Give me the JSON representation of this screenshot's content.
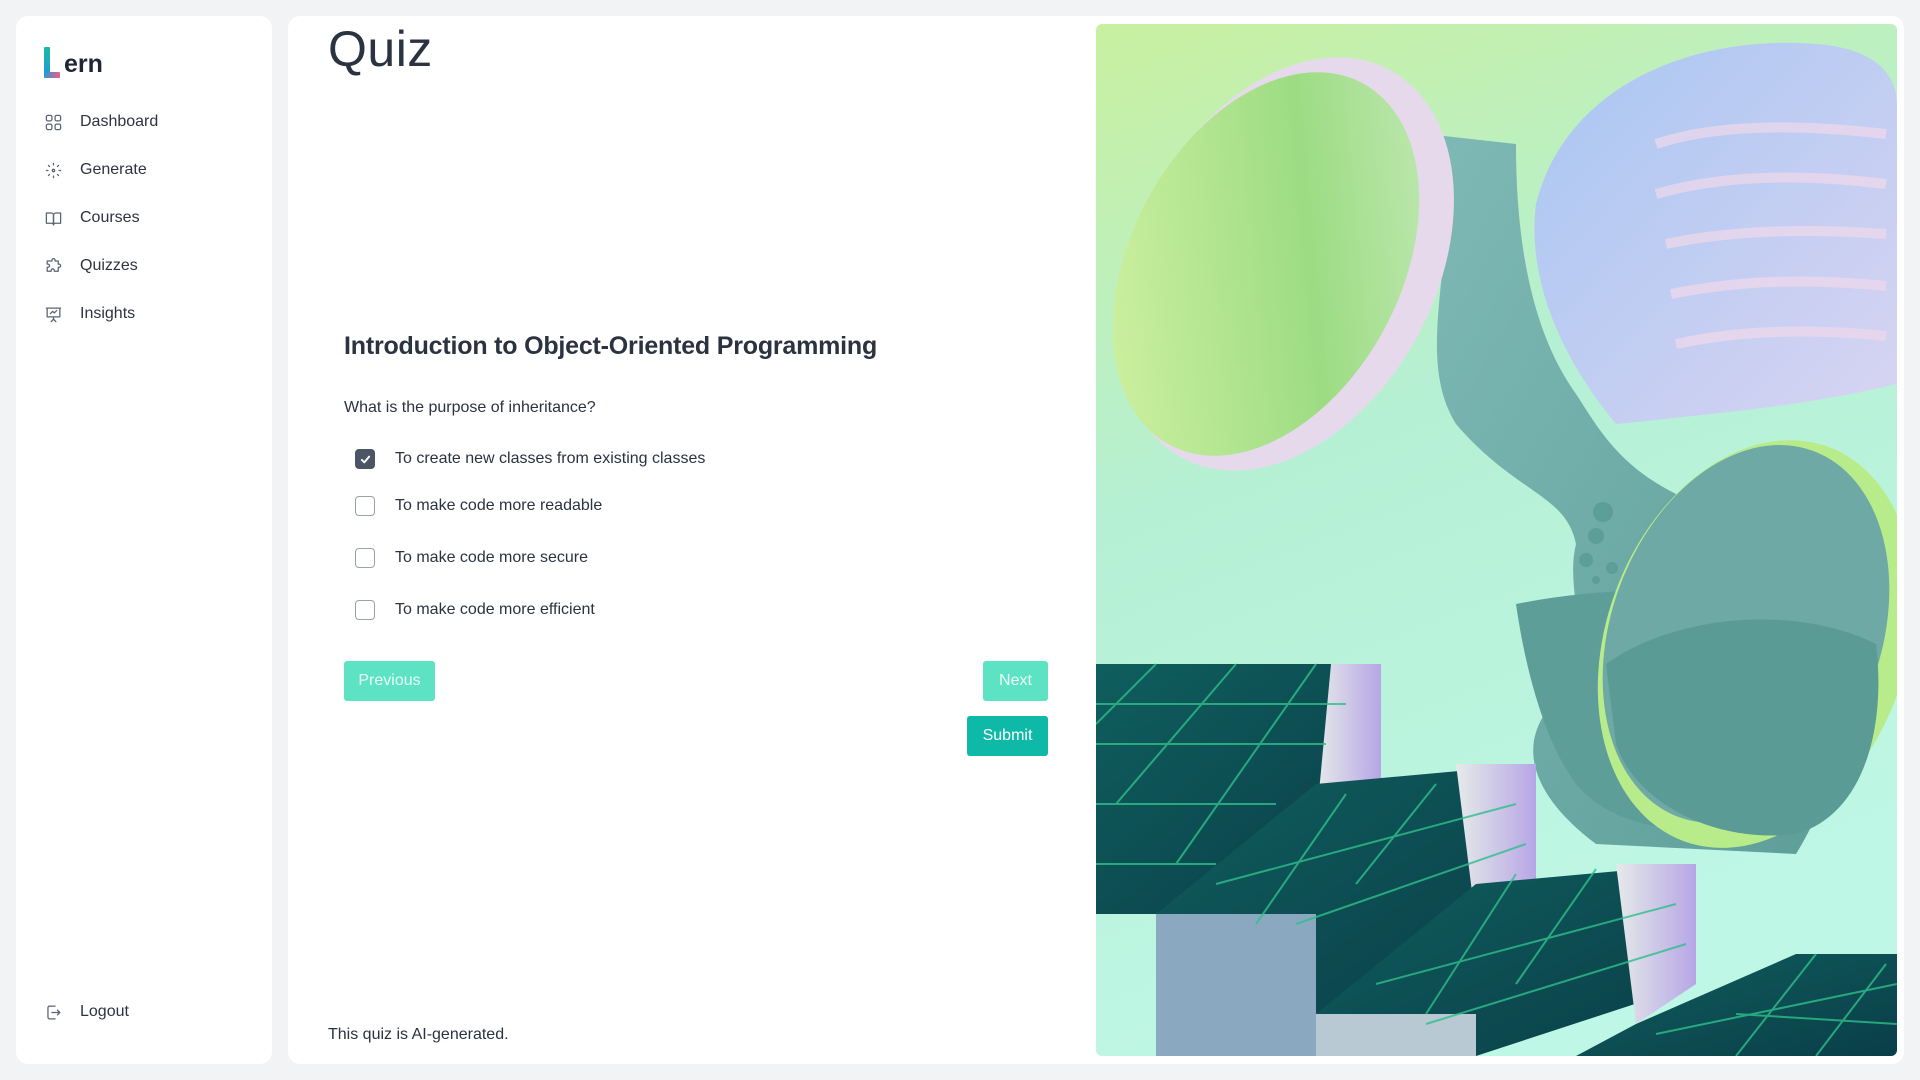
{
  "app": {
    "logo_text": "ern"
  },
  "sidebar": {
    "items": [
      {
        "label": "Dashboard",
        "icon": "dashboard-icon"
      },
      {
        "label": "Generate",
        "icon": "generate-icon"
      },
      {
        "label": "Courses",
        "icon": "book-icon"
      },
      {
        "label": "Quizzes",
        "icon": "puzzle-icon"
      },
      {
        "label": "Insights",
        "icon": "presentation-chart-icon"
      }
    ],
    "logout": {
      "label": "Logout",
      "icon": "logout-icon"
    }
  },
  "page": {
    "title": "Quiz",
    "quiz_title": "Introduction to Object-Oriented Programming",
    "question": "What is the purpose of inheritance?",
    "options": [
      {
        "label": "To create new classes from existing classes",
        "checked": true
      },
      {
        "label": "To make code more readable",
        "checked": false
      },
      {
        "label": "To make code more secure",
        "checked": false
      },
      {
        "label": "To make code more efficient",
        "checked": false
      }
    ],
    "buttons": {
      "previous": "Previous",
      "next": "Next",
      "submit": "Submit"
    },
    "footnote": "This quiz is AI-generated."
  },
  "colors": {
    "accent": "#0fb9a8",
    "accent_light": "#5de3c3",
    "checkbox_checked": "#4b5563"
  }
}
